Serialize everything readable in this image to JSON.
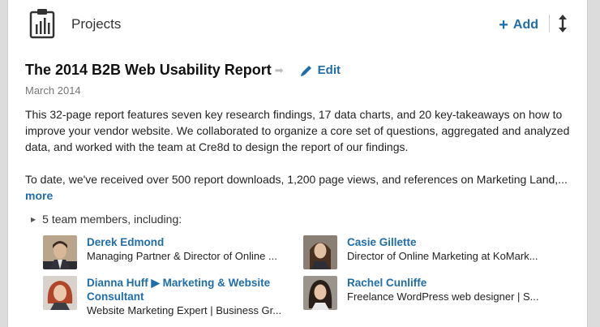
{
  "section": {
    "title": "Projects",
    "icon": "clipboard-chart-icon"
  },
  "actions": {
    "add_label": "Add",
    "add_icon": "plus-icon",
    "sort_icon": "reorder-arrows-icon"
  },
  "project": {
    "title": "The 2014 B2B Web Usability Report",
    "edit_label": "Edit",
    "date": "March 2014",
    "description_1": "This 32-page report features seven key research findings, 17 data charts, and 20 key-takeaways on how to improve your vendor website. We collaborated to organize a core set of questions, aggregated and analyzed data, and worked with the team at Cre8d to design the report of our findings.",
    "description_2": "To date, we've received over 500 report downloads, 1,200 page views, and references on Marketing Land,...",
    "more_label": "more"
  },
  "team": {
    "toggle_label": "5 team members, including:",
    "members": [
      {
        "name": "Derek Edmond",
        "headline": "Managing Partner & Director of Online ..."
      },
      {
        "name": "Casie Gillette",
        "headline": "Director of Online Marketing at KoMark..."
      },
      {
        "name": "Dianna Huff ▶ Marketing & Website Consultant",
        "headline": "Website Marketing Expert | Business Gr..."
      },
      {
        "name": "Rachel Cunliffe",
        "headline": "Freelance WordPress web designer | S..."
      }
    ]
  },
  "colors": {
    "link": "#1f6ea9",
    "text": "#222222",
    "muted": "#777777"
  }
}
